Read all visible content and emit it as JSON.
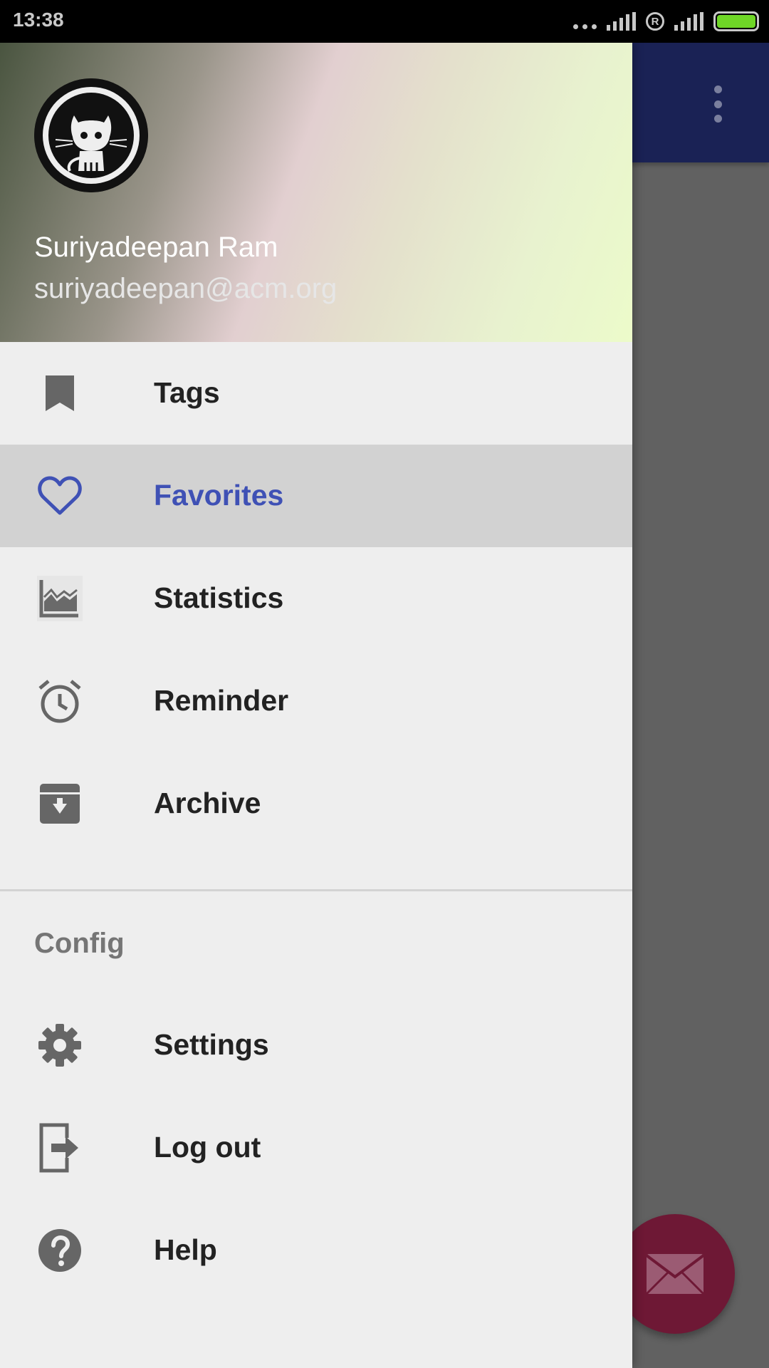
{
  "status_bar": {
    "time": "13:38",
    "roaming_label": "R",
    "battery_color": "#6fd627"
  },
  "background": {
    "appbar_color": "#1a2255",
    "overflow_icon": "more-vert-icon",
    "fab_icon": "email-icon",
    "fab_color": "#6e1835"
  },
  "drawer": {
    "header": {
      "avatar_icon": "github-octocat-icon",
      "name": "Suriyadeepan Ram",
      "email": "suriyadeepan@acm.org"
    },
    "primary_items": [
      {
        "label": "Tags",
        "icon": "bookmark-icon",
        "active": false
      },
      {
        "label": "Favorites",
        "icon": "heart-outline-icon",
        "active": true
      },
      {
        "label": "Statistics",
        "icon": "chart-icon",
        "active": false
      },
      {
        "label": "Reminder",
        "icon": "alarm-clock-icon",
        "active": false
      },
      {
        "label": "Archive",
        "icon": "archive-icon",
        "active": false
      }
    ],
    "section_title": "Config",
    "secondary_items": [
      {
        "label": "Settings",
        "icon": "gear-icon"
      },
      {
        "label": "Log out",
        "icon": "logout-icon"
      },
      {
        "label": "Help",
        "icon": "help-icon"
      }
    ],
    "accent_color": "#3f51b5"
  }
}
